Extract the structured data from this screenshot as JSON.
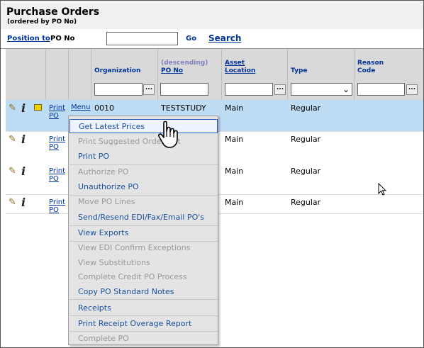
{
  "header": {
    "title": "Purchase Orders",
    "subtitle": "(ordered by PO No)"
  },
  "position_bar": {
    "link": "Position to",
    "field_label": "PO No",
    "input_value": "",
    "go": "Go",
    "search": "Search"
  },
  "columns": {
    "organization": "Organization",
    "po_desc": "(descending)",
    "po_no": "PO No",
    "asset_1": "Asset",
    "asset_2": "Location",
    "type": "Type",
    "reason_1": "Reason",
    "reason_2": "Code",
    "dots": "..."
  },
  "rows": [
    {
      "print_1": "Print",
      "print_2": "PO",
      "menu": "Menu",
      "org": "0010",
      "po": "TESTSTUDY",
      "asset": "Main",
      "type": "Regular"
    },
    {
      "print_1": "Print",
      "print_2": "PO",
      "asset": "Main",
      "type": "Regular"
    },
    {
      "print_1": "Print",
      "print_2": "PO",
      "asset": "Main",
      "type": "Regular"
    },
    {
      "print_1": "Print",
      "print_2": "PO",
      "asset": "Main",
      "type": "Regular"
    }
  ],
  "menu_items": [
    {
      "label": "Get Latest Prices",
      "state": "enabled-highlighted"
    },
    {
      "label": "Print Suggested Order List",
      "state": "disabled"
    },
    {
      "label": "Print PO",
      "state": "enabled"
    },
    {
      "label": "Authorize PO",
      "state": "disabled"
    },
    {
      "label": "Unauthorize PO",
      "state": "enabled"
    },
    {
      "label": "Move PO Lines",
      "state": "disabled"
    },
    {
      "label": "Send/Resend EDI/Fax/Email PO's",
      "state": "enabled"
    },
    {
      "label": "View Exports",
      "state": "enabled"
    },
    {
      "label": "View EDI Confirm Exceptions",
      "state": "disabled"
    },
    {
      "label": "View Substitutions",
      "state": "disabled"
    },
    {
      "label": "Complete Credit PO Process",
      "state": "disabled"
    },
    {
      "label": "Copy PO Standard Notes",
      "state": "enabled"
    },
    {
      "label": "Receipts",
      "state": "enabled"
    },
    {
      "label": "Print Receipt Overage Report",
      "state": "enabled"
    },
    {
      "label": "Complete PO",
      "state": "disabled"
    }
  ],
  "colors": {
    "link": "#003399",
    "selected_row": "#bfdcf5",
    "header_bg": "#d9d9d9",
    "menu_bg": "#e4e4e4"
  },
  "icons": [
    "pencil-icon",
    "info-icon",
    "note-icon",
    "hand-cursor-icon",
    "arrow-cursor-icon",
    "ellipsis-icon",
    "chevron-down-icon"
  ]
}
